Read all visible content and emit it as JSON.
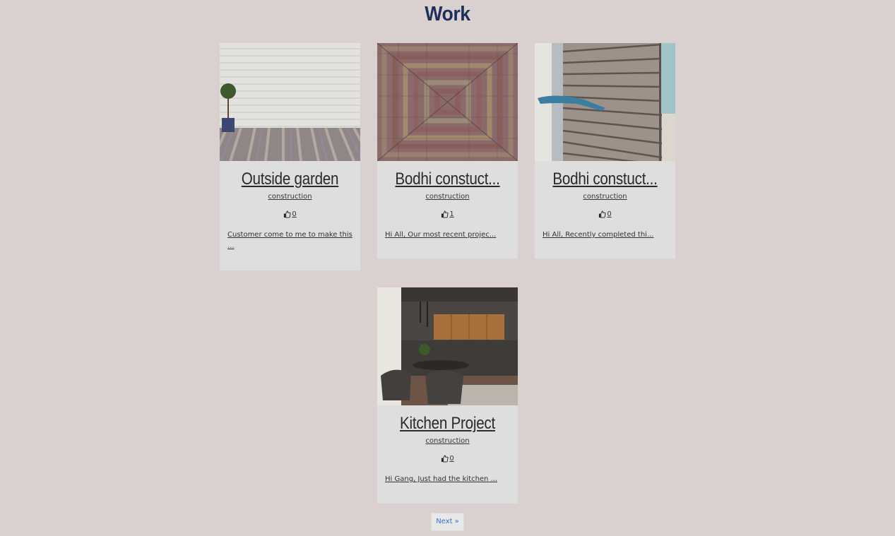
{
  "page": {
    "title": "Work"
  },
  "cards": [
    {
      "title": "Outside garden",
      "category": "construction",
      "likes": "0",
      "excerpt": "Customer come to me to make this ...",
      "image": "white-brick-wall-with-plant"
    },
    {
      "title": "Bodhi constuct...",
      "category": "construction",
      "likes": "1",
      "excerpt": "Hi All, Our most recent projec...",
      "image": "brick-paving-pattern"
    },
    {
      "title": "Bodhi constuct...",
      "category": "construction",
      "likes": "0",
      "excerpt": "Hi All, Recently completed thi...",
      "image": "brick-wall-with-level"
    },
    {
      "title": "Kitchen Project",
      "category": "construction",
      "likes": "0",
      "excerpt": "Hi Gang, Just had the kitchen ...",
      "image": "modern-kitchen-interior"
    }
  ],
  "pagination": {
    "next_label": "Next »"
  },
  "icons": {
    "like": "thumbs-up-icon"
  }
}
